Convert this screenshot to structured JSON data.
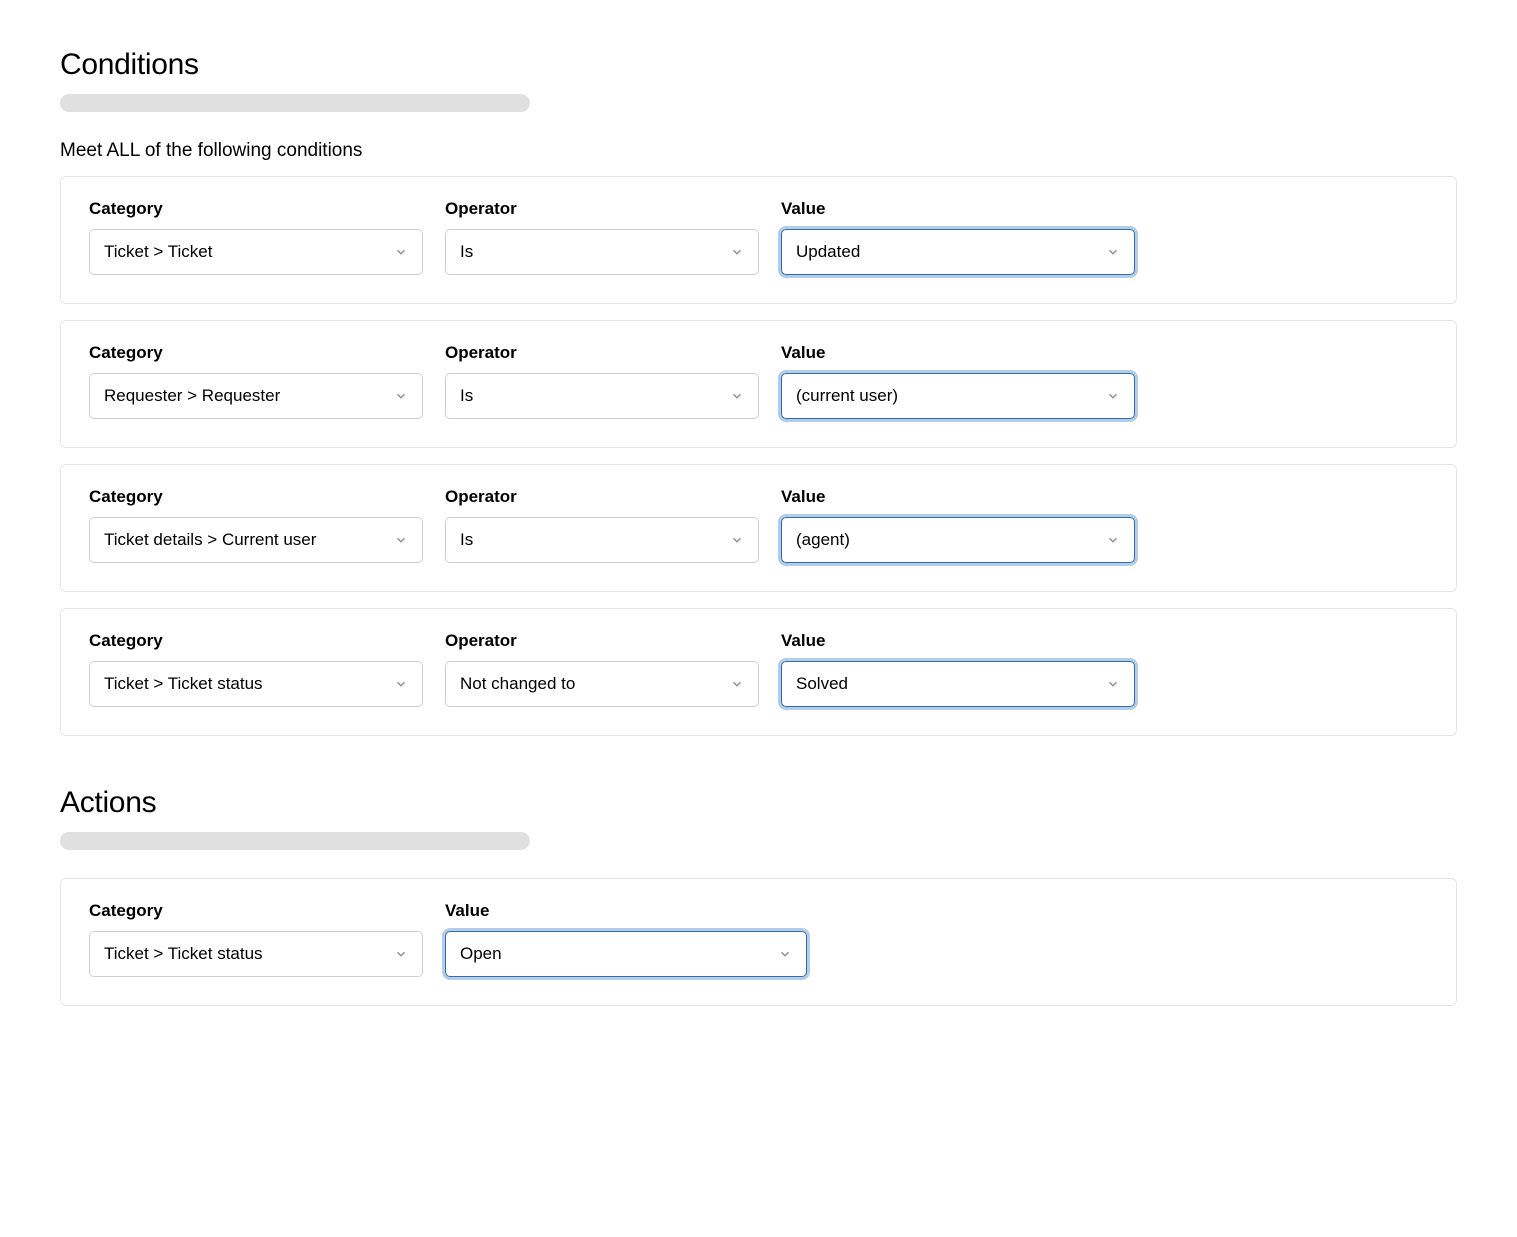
{
  "conditions": {
    "title": "Conditions",
    "subheading": "Meet ALL of the following conditions",
    "labels": {
      "category": "Category",
      "operator": "Operator",
      "value": "Value"
    },
    "rows": [
      {
        "category": "Ticket > Ticket",
        "operator": "Is",
        "value": "Updated"
      },
      {
        "category": "Requester > Requester",
        "operator": "Is",
        "value": "(current user)"
      },
      {
        "category": "Ticket details > Current user",
        "operator": "Is",
        "value": "(agent)"
      },
      {
        "category": "Ticket > Ticket status",
        "operator": "Not changed to",
        "value": "Solved"
      }
    ]
  },
  "actions": {
    "title": "Actions",
    "labels": {
      "category": "Category",
      "value": "Value"
    },
    "rows": [
      {
        "category": "Ticket > Ticket status",
        "value": "Open"
      }
    ]
  }
}
